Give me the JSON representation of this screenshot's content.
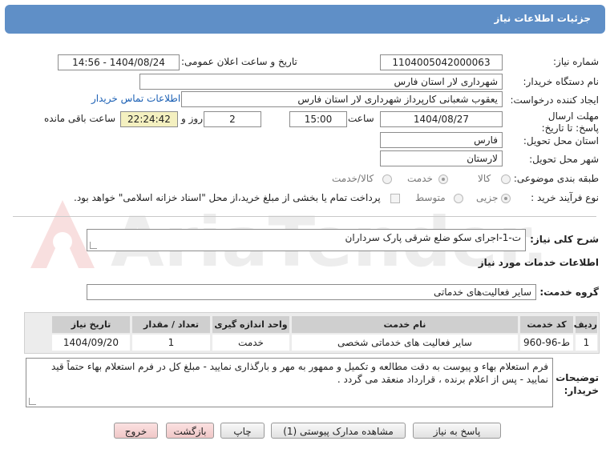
{
  "title": "جزئیات اطلاعات نیاز",
  "fields": {
    "need_number_label": "شماره نیاز:",
    "need_number": "1104005042000063",
    "announce_label": "تاریخ و ساعت اعلان عمومی:",
    "announce_value": "1404/08/24 - 14:56",
    "buyer_org_label": "نام دستگاه خریدار:",
    "buyer_org": "شهرداری لار استان فارس",
    "creator_label": "ایجاد کننده درخواست:",
    "creator": "یعقوب شعبانی کارپرداز شهرداری لار استان فارس",
    "contact_link": "اطلاعات تماس خریدار",
    "deadline_label": "مهلت ارسال پاسخ: تا تاریخ:",
    "deadline_date": "1404/08/27",
    "time_label": "ساعت",
    "deadline_time": "15:00",
    "days_value": "2",
    "days_label": "روز و",
    "remaining_time": "22:24:42",
    "remaining_label": "ساعت باقی مانده",
    "province_label": "استان محل تحویل:",
    "province": "فارس",
    "city_label": "شهر محل تحویل:",
    "city": "لارستان",
    "category_label": "طبقه بندی موضوعی:",
    "category_options": [
      "کالا",
      "خدمت",
      "کالا/خدمت"
    ],
    "category_selected": "خدمت",
    "process_label": "نوع فرآیند خرید :",
    "process_options": [
      "جزیی",
      "متوسط"
    ],
    "process_selected": "جزیی",
    "payment_note": "پرداخت تمام یا بخشی از مبلغ خرید،از محل \"اسناد خزانه اسلامی\" خواهد بود."
  },
  "description": {
    "label": "شرح کلی نیاز:",
    "value": "ت-1-اجرای سکو ضلع شرقی پارک سرداران"
  },
  "services_header": "اطلاعات خدمات مورد نیاز",
  "service_group": {
    "label": "گروه خدمت:",
    "value": "سایر فعالیت‌های خدماتی"
  },
  "table": {
    "headers": [
      "ردیف",
      "کد خدمت",
      "نام خدمت",
      "واحد اندازه گیری",
      "تعداد / مقدار",
      "تاریخ نیاز"
    ],
    "rows": [
      [
        "1",
        "ط-96-960",
        "سایر فعالیت های خدماتی شخصی",
        "خدمت",
        "1",
        "1404/09/20"
      ]
    ]
  },
  "buyer_notes": {
    "label": "توضیحات خریدار:",
    "value": "فرم استعلام بهاء و پیوست به دقت مطالعه و تکمیل و ممهور به مهر و بارگذاری نمایید - مبلغ کل در فرم استعلام بهاء حتماً قید نمایید - پس از اعلام برنده ، قرارداد منعقد می گردد ."
  },
  "buttons": {
    "reply": "پاسخ به نیاز",
    "attachments": "مشاهده مدارک پیوستی (1)",
    "print": "چاپ",
    "back": "بازگشت",
    "exit": "خروج"
  },
  "watermark": "AriaTender.net"
}
